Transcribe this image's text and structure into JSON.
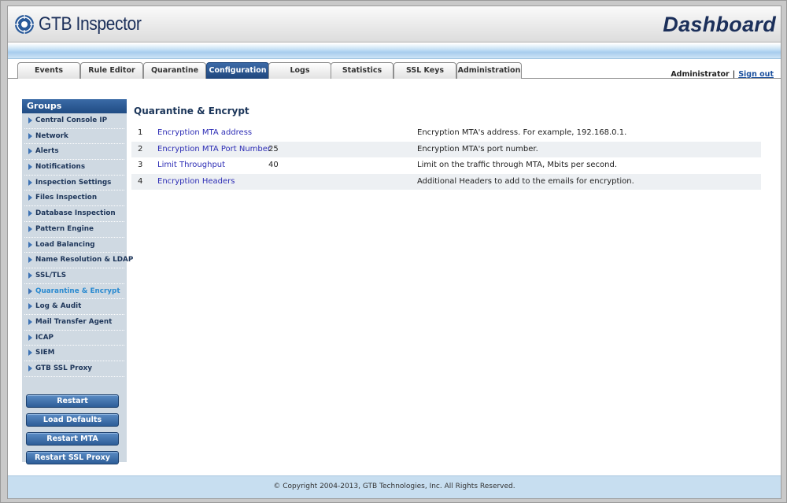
{
  "header": {
    "logo_text": "GTB Inspector",
    "page_title": "Dashboard"
  },
  "tabs": [
    {
      "label": "Events",
      "active": false
    },
    {
      "label": "Rule Editor",
      "active": false
    },
    {
      "label": "Quarantine",
      "active": false
    },
    {
      "label": "Configuration",
      "active": true
    },
    {
      "label": "Logs",
      "active": false
    },
    {
      "label": "Statistics",
      "active": false
    },
    {
      "label": "SSL Keys",
      "active": false
    },
    {
      "label": "Administration",
      "active": false
    }
  ],
  "user": {
    "name": "Administrator",
    "separator": "|",
    "sign_out": "Sign out"
  },
  "sidebar": {
    "title": "Groups",
    "items": [
      {
        "label": "Central Console IP"
      },
      {
        "label": "Network"
      },
      {
        "label": "Alerts"
      },
      {
        "label": "Notifications"
      },
      {
        "label": "Inspection Settings"
      },
      {
        "label": "Files Inspection"
      },
      {
        "label": "Database Inspection"
      },
      {
        "label": "Pattern Engine"
      },
      {
        "label": "Load Balancing"
      },
      {
        "label": "Name Resolution & LDAP"
      },
      {
        "label": "SSL/TLS"
      },
      {
        "label": "Quarantine & Encrypt"
      },
      {
        "label": "Log & Audit"
      },
      {
        "label": "Mail Transfer Agent"
      },
      {
        "label": "ICAP"
      },
      {
        "label": "SIEM"
      },
      {
        "label": "GTB SSL Proxy"
      }
    ],
    "active_index": 11,
    "buttons": [
      {
        "label": "Restart"
      },
      {
        "label": "Load Defaults"
      },
      {
        "label": "Restart MTA"
      },
      {
        "label": "Restart SSL Proxy"
      }
    ]
  },
  "main": {
    "title": "Quarantine & Encrypt",
    "rows": [
      {
        "num": "1",
        "name": "Encryption MTA address",
        "value": "",
        "desc": "Encryption MTA's address. For example, 192.168.0.1."
      },
      {
        "num": "2",
        "name": "Encryption MTA Port Number",
        "value": "25",
        "desc": "Encryption MTA's port number."
      },
      {
        "num": "3",
        "name": "Limit Throughput",
        "value": "40",
        "desc": "Limit on the traffic through MTA, Mbits per second."
      },
      {
        "num": "4",
        "name": "Encryption Headers",
        "value": "",
        "desc": "Additional Headers to add to the emails for encryption."
      }
    ]
  },
  "footer": {
    "copyright": "© Copyright 2004-2013, GTB Technologies, Inc. All Rights Reserved."
  },
  "colors": {
    "brand_navy": "#1b2f5a",
    "active_tab": "#2b5690",
    "link_blue": "#2d2db5",
    "active_sidebar_item": "#2a8ad0"
  },
  "icons": {
    "logo": "gtb-logo-icon",
    "sidebar_item": "triangle-right-icon"
  }
}
